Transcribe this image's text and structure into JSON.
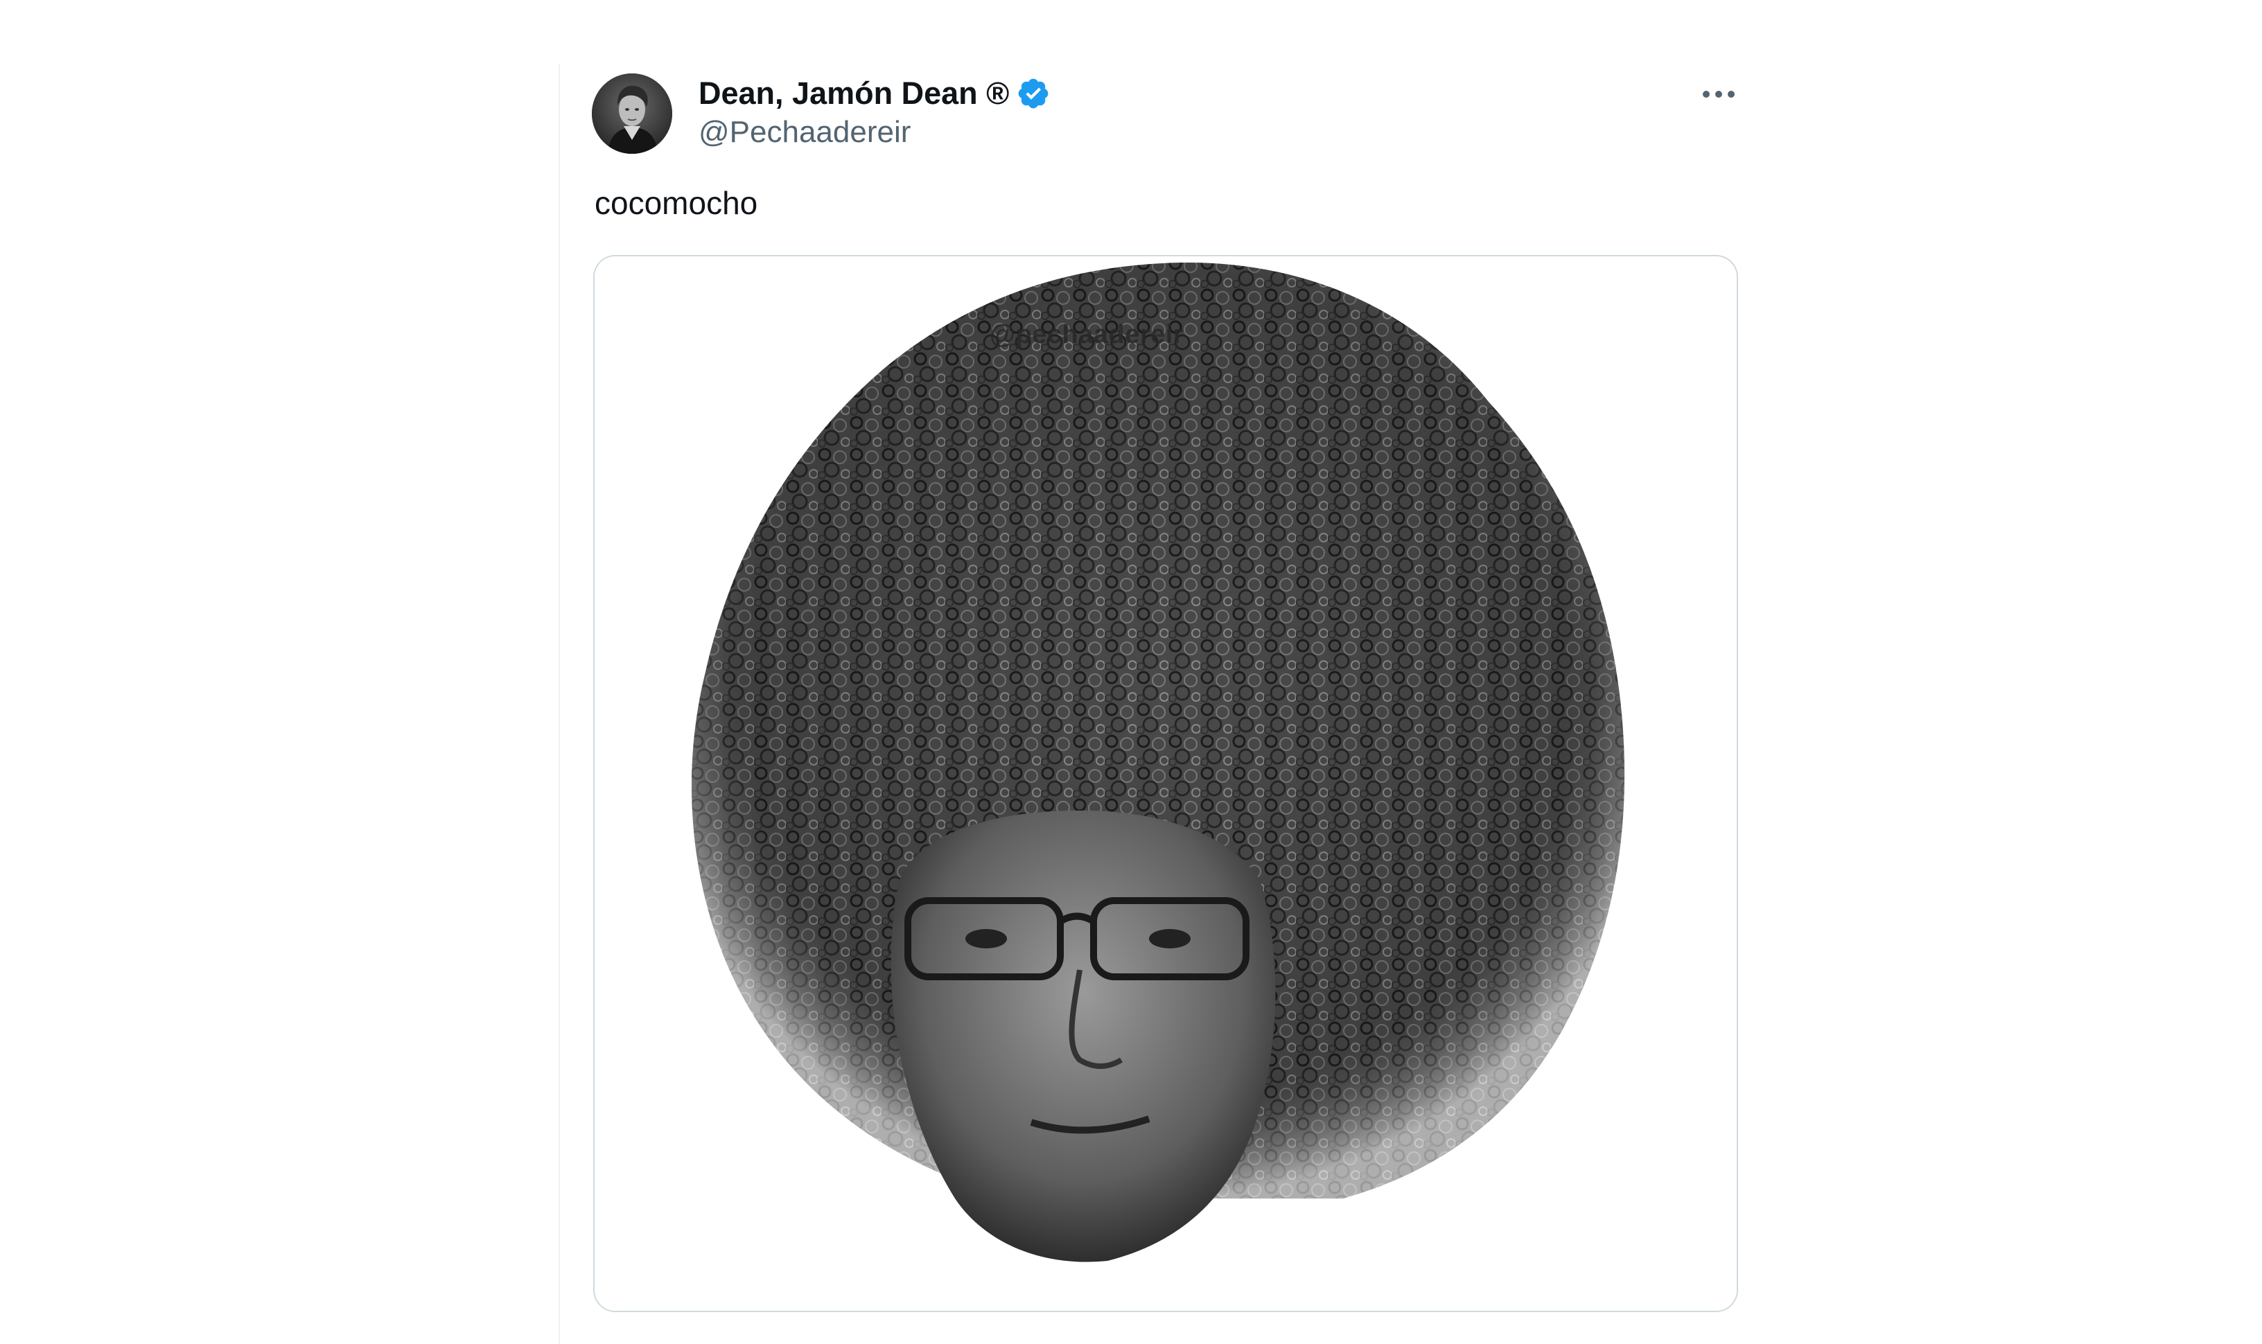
{
  "tweet": {
    "display_name": "Dean, Jamón Dean ®",
    "handle": "@Pechaadereir",
    "text": "cocomocho",
    "verified": true,
    "media": {
      "watermark": "@pechaadereir"
    }
  },
  "icons": {
    "verified": "verified-badge-icon",
    "more": "more-options-icon",
    "verified_color": "#1d9bf0"
  },
  "colors": {
    "text_primary": "#0f1419",
    "text_secondary": "#536471",
    "card_border": "#cfd9de"
  }
}
